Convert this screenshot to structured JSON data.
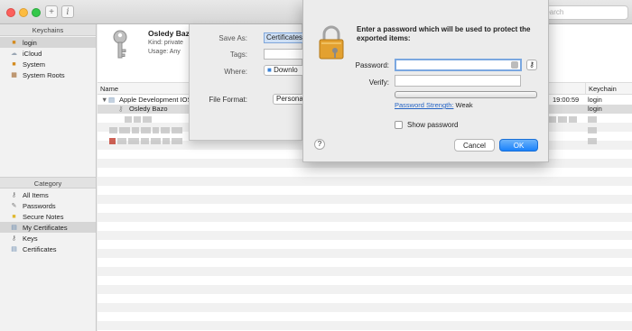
{
  "toolbar": {
    "search_placeholder": "Search",
    "colors": {
      "close": "#fc605c",
      "minimize": "#fdbc40",
      "zoom": "#34c84a"
    }
  },
  "sidebar": {
    "keychains_header": "Keychains",
    "keychains": [
      {
        "label": "login",
        "icon": "lock-icon",
        "selected": true
      },
      {
        "label": "iCloud",
        "icon": "cloud-icon",
        "selected": false
      },
      {
        "label": "System",
        "icon": "lock-icon",
        "selected": false
      },
      {
        "label": "System Roots",
        "icon": "cabinet-icon",
        "selected": false
      }
    ],
    "category_header": "Category",
    "categories": [
      {
        "label": "All Items",
        "icon": "keys-icon",
        "selected": false
      },
      {
        "label": "Passwords",
        "icon": "pen-icon",
        "selected": false
      },
      {
        "label": "Secure Notes",
        "icon": "note-icon",
        "selected": false
      },
      {
        "label": "My Certificates",
        "icon": "certificate-icon",
        "selected": true
      },
      {
        "label": "Keys",
        "icon": "key-icon",
        "selected": false
      },
      {
        "label": "Certificates",
        "icon": "certificate-icon",
        "selected": false
      }
    ]
  },
  "detail": {
    "name": "Osledy Bazo",
    "kind_label": "Kind:",
    "kind_value": "private",
    "usage_label": "Usage:",
    "usage_value": "Any"
  },
  "list": {
    "columns": {
      "name": "Name",
      "keychain": "Keychain"
    },
    "rows": [
      {
        "name": "Apple Development IOS",
        "date": "19:00:59",
        "keychain": "login",
        "selected": false
      },
      {
        "name": "Osledy Bazo",
        "date": "",
        "keychain": "login",
        "selected": true
      }
    ]
  },
  "export_sheet": {
    "save_as_label": "Save As:",
    "save_as_value": "Certificates",
    "tags_label": "Tags:",
    "where_label": "Where:",
    "where_value": "Downlo",
    "format_label": "File Format:",
    "format_value": "Persona"
  },
  "password_dialog": {
    "message": "Enter a password which will be used to protect the exported items:",
    "password_label": "Password:",
    "verify_label": "Verify:",
    "strength_link": "Password Strength:",
    "strength_value": "Weak",
    "show_password_label": "Show password",
    "help_label": "?",
    "cancel_label": "Cancel",
    "ok_label": "OK"
  }
}
